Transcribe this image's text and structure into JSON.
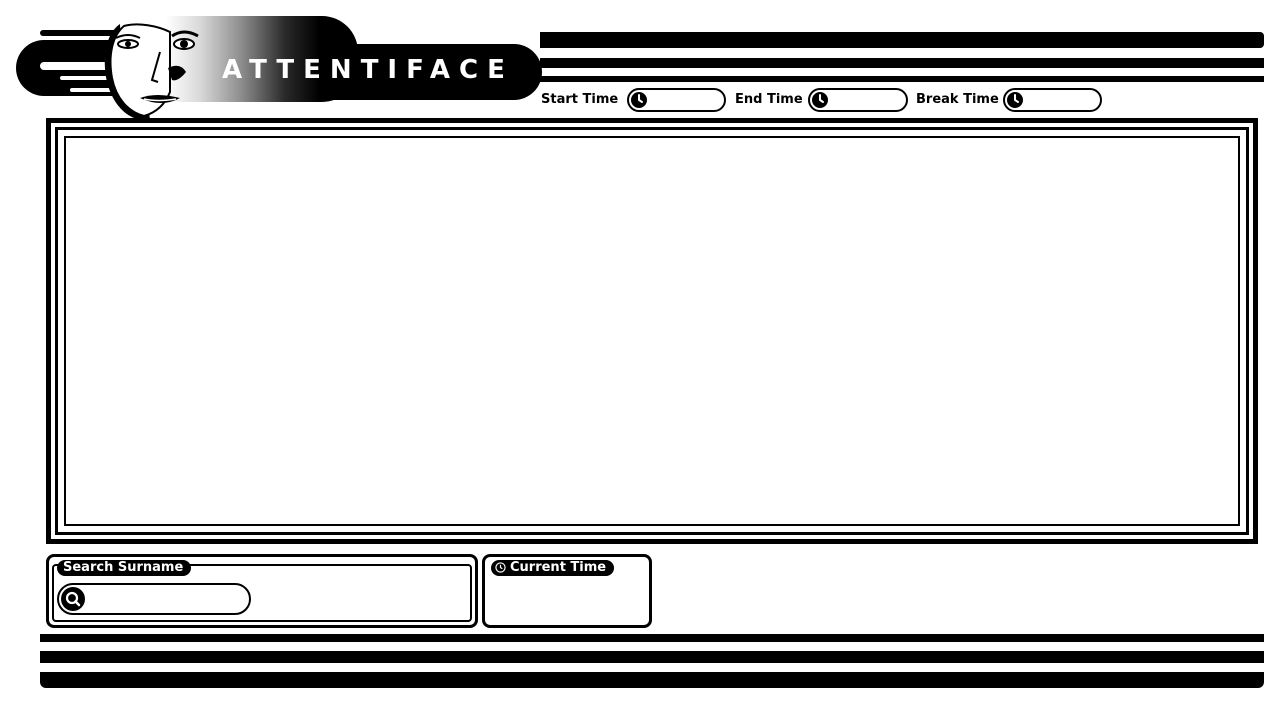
{
  "brand": {
    "name": "ATTENTIFACE"
  },
  "time_fields": {
    "start": {
      "label": "Start Time",
      "value": ""
    },
    "end": {
      "label": "End Time",
      "value": ""
    },
    "break": {
      "label": "Break Time",
      "value": ""
    }
  },
  "search": {
    "label": "Search Surname",
    "value": ""
  },
  "current_time": {
    "label": "Current Time",
    "value": ""
  },
  "colors": {
    "ink": "#000000",
    "paper": "#ffffff"
  },
  "icons": {
    "time": "clock-icon",
    "search": "search-icon",
    "logo": "face-logo"
  }
}
